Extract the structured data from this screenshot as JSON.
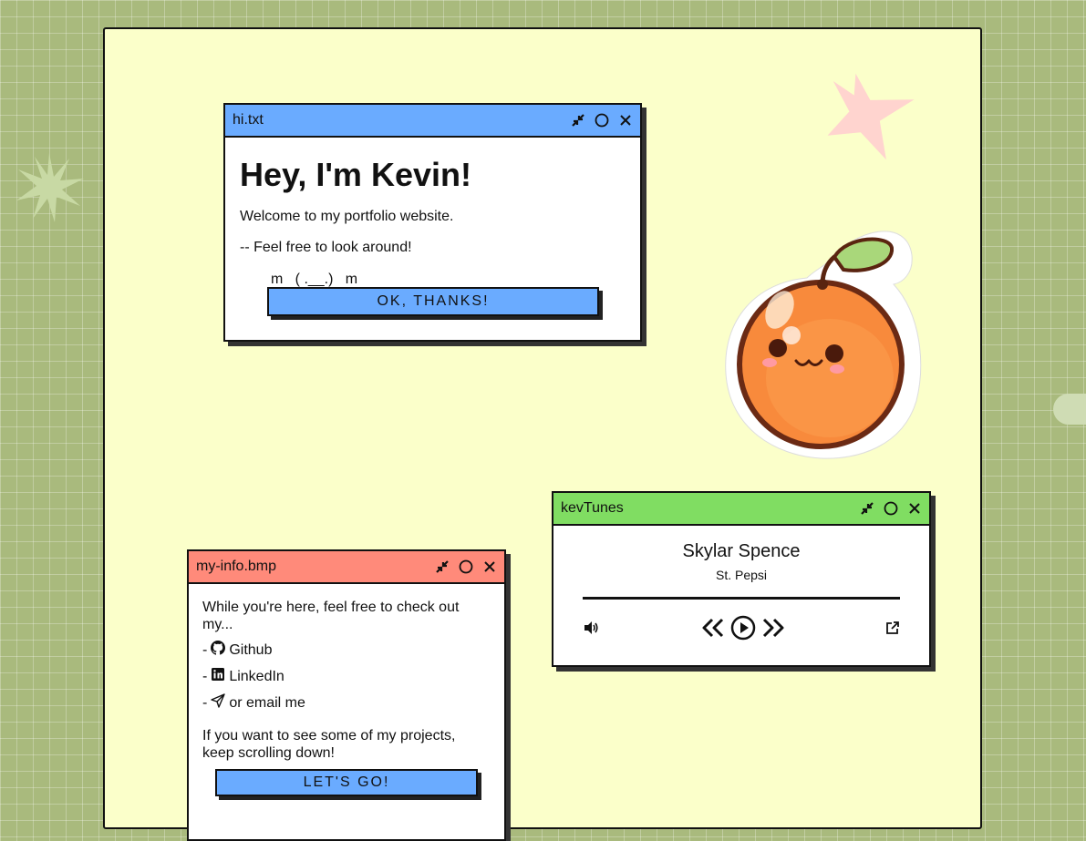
{
  "hi_window": {
    "title": "hi.txt",
    "heading": "Hey, I'm Kevin!",
    "line1": "Welcome to my portfolio website.",
    "line2": "-- Feel free to look around!",
    "kaomoji": "m   ( .__.)   m",
    "button_label": "OK, THANKS!"
  },
  "info_window": {
    "title": "my-info.bmp",
    "intro": "While you're here, feel free to check out my...",
    "links": [
      {
        "prefix": "-",
        "icon": "github-icon",
        "label": "Github"
      },
      {
        "prefix": "-",
        "icon": "linkedin-icon",
        "label": "LinkedIn"
      },
      {
        "prefix": "-",
        "icon": "paper-plane-icon",
        "label": "or email me"
      }
    ],
    "outro": "If you want to see some of my projects, keep scrolling down!",
    "button_label": "LET'S GO!"
  },
  "tunes_window": {
    "title": "kevTunes",
    "song": "Skylar Spence",
    "artist": "St. Pepsi",
    "progress": 1.0
  },
  "colors": {
    "background": "#a9ba7d",
    "panel": "#fbffca",
    "hi_titlebar": "#6aabff",
    "info_titlebar": "#ff8a7a",
    "tunes_titlebar": "#80dd62",
    "button": "#6aabff"
  }
}
